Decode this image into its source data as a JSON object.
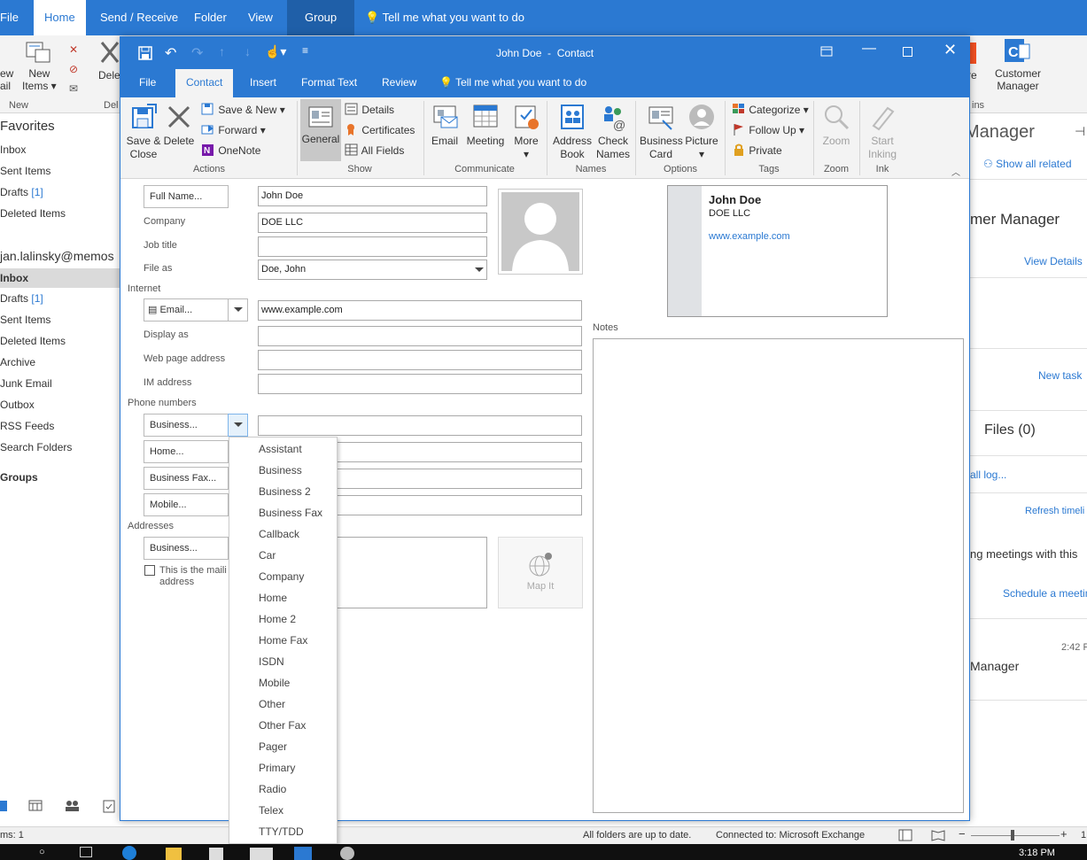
{
  "background": {
    "tabs": [
      "File",
      "Home",
      "Send / Receive",
      "Folder",
      "View",
      "Group"
    ],
    "tell_me": "Tell me what you want to do",
    "ribbon_new_label": "New\nItems",
    "ribbon_new_label_a": "New",
    "ribbon_new_label_b": "Items",
    "ribbon_view_partial": "ew",
    "ribbon_mail_partial": "ail",
    "ribbon_group_new": "New",
    "ribbon_dele_partial": "Dele",
    "ribbon_del_partial": "Del",
    "ribbon_re_partial": "re",
    "ribbon_ins_partial": "ins",
    "customer_manager": [
      "Customer",
      "Manager"
    ],
    "favorites": "Favorites",
    "fav_items": [
      "Inbox",
      "Sent Items",
      "Drafts",
      "Deleted Items"
    ],
    "drafts_count": "[1]",
    "account": "jan.lalinsky@memos",
    "account_items": [
      "Inbox",
      "Drafts",
      "Sent Items",
      "Deleted Items",
      "Archive",
      "Junk Email",
      "Outbox",
      "RSS Feeds",
      "Search Folders"
    ],
    "groups": "Groups",
    "right_title": "Manager",
    "show_all_related": "Show all related",
    "mer_manager": "mer Manager",
    "view_details": "View Details",
    "new_task": "New task",
    "files": "Files (0)",
    "all_log": "all log...",
    "refresh": "Refresh timeli",
    "meetings": "ng meetings with this",
    "schedule": "Schedule a meetin",
    "time": "2:42 P",
    "manager": "Manager"
  },
  "status": {
    "items": "ms: 1",
    "sync": "All folders are up to date.",
    "connected": "Connected to: Microsoft Exchange",
    "zoom_partial": "1"
  },
  "taskbar": {
    "time": "3:18 PM"
  },
  "dialog": {
    "title": "John Doe  -  Contact",
    "tabs": [
      "File",
      "Contact",
      "Insert",
      "Format Text",
      "Review"
    ],
    "tell_me": "Tell me what you want to do",
    "ribbon": {
      "save_close": [
        "Save &",
        "Close"
      ],
      "delete": "Delete",
      "save_new": "Save & New",
      "forward": "Forward",
      "onenote": "OneNote",
      "actions": "Actions",
      "general": "General",
      "details": "Details",
      "certificates": "Certificates",
      "all_fields": "All Fields",
      "show": "Show",
      "email": "Email",
      "meeting": "Meeting",
      "more": "More",
      "communicate": "Communicate",
      "address_book": [
        "Address",
        "Book"
      ],
      "check_names": [
        "Check",
        "Names"
      ],
      "names": "Names",
      "business_card": [
        "Business",
        "Card"
      ],
      "picture": "Picture",
      "options": "Options",
      "categorize": "Categorize",
      "follow_up": "Follow Up",
      "private": "Private",
      "tags": "Tags",
      "zoom_btn": "Zoom",
      "zoom_group": "Zoom",
      "start_inking": [
        "Start",
        "Inking"
      ],
      "ink": "Ink"
    },
    "form": {
      "full_name_btn": "Full Name...",
      "full_name": "John Doe",
      "company_label": "Company",
      "company": "DOE LLC",
      "job_title_label": "Job title",
      "job_title": "",
      "file_as_label": "File as",
      "file_as": "Doe, John",
      "internet": "Internet",
      "email_btn": "Email...",
      "email": "www.example.com",
      "display_as_label": "Display as",
      "web_label": "Web page address",
      "im_label": "IM address",
      "phone_numbers": "Phone numbers",
      "phone_btns": [
        "Business...",
        "Home...",
        "Business Fax...",
        "Mobile..."
      ],
      "addresses": "Addresses",
      "address_btn": "Business...",
      "mailing_label": [
        "This is the maili",
        "address"
      ],
      "map_it": "Map It",
      "notes": "Notes"
    },
    "card": {
      "name": "John Doe",
      "company": "DOE LLC",
      "web": "www.example.com"
    },
    "phone_menu": [
      "Assistant",
      "Business",
      "Business 2",
      "Business Fax",
      "Callback",
      "Car",
      "Company",
      "Home",
      "Home 2",
      "Home Fax",
      "ISDN",
      "Mobile",
      "Other",
      "Other Fax",
      "Pager",
      "Primary",
      "Radio",
      "Telex",
      "TTY/TDD"
    ]
  }
}
